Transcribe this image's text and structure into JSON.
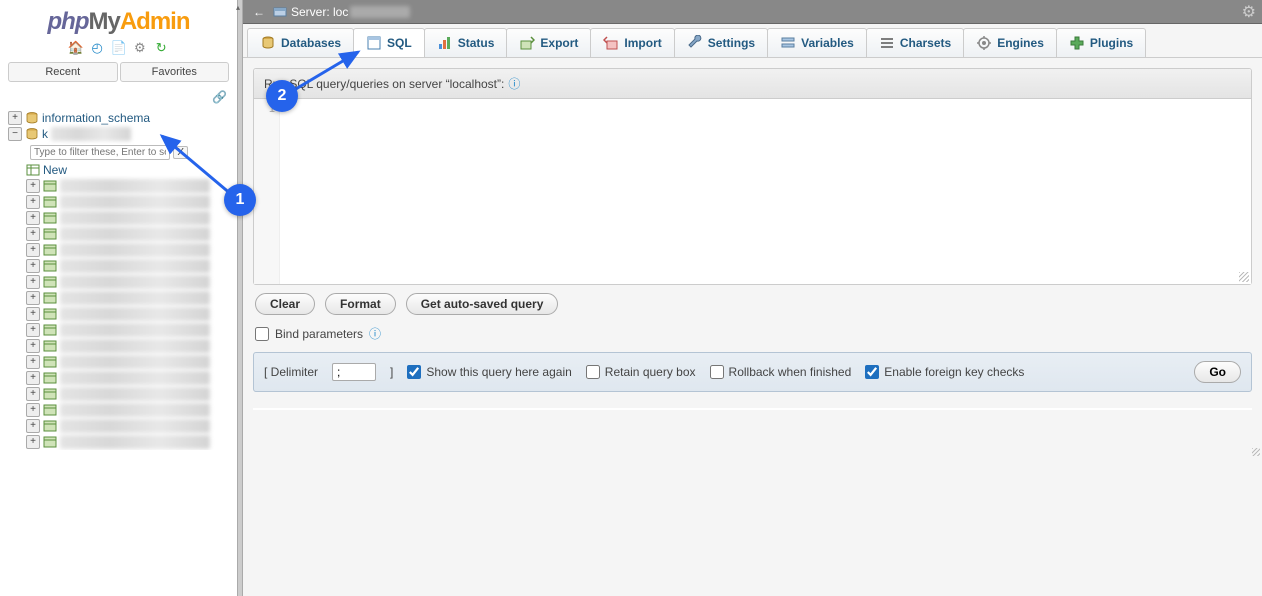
{
  "logo": {
    "php": "php",
    "my": "My",
    "admin": "Admin"
  },
  "sidebar_tabs": {
    "recent": "Recent",
    "favorites": "Favorites"
  },
  "tree": {
    "db1": "information_schema",
    "db2": "k",
    "filter_placeholder": "Type to filter these, Enter to search",
    "filter_x": "X",
    "new": "New"
  },
  "topbar": {
    "server_label": "Server: loc"
  },
  "tabs": {
    "databases": "Databases",
    "sql": "SQL",
    "status": "Status",
    "export": "Export",
    "import": "Import",
    "settings": "Settings",
    "variables": "Variables",
    "charsets": "Charsets",
    "engines": "Engines",
    "plugins": "Plugins"
  },
  "sql": {
    "header": "Run SQL query/queries on server “localhost”:",
    "line1": "1",
    "clear": "Clear",
    "format": "Format",
    "get_autosaved": "Get auto-saved query",
    "bind_params": "Bind parameters"
  },
  "options": {
    "delimiter_label_open": "[ Delimiter",
    "delimiter_value": ";",
    "delimiter_label_close": "]",
    "show_again": "Show this query here again",
    "retain": "Retain query box",
    "rollback": "Rollback when finished",
    "fk": "Enable foreign key checks",
    "go": "Go"
  },
  "annotations": {
    "one": "1",
    "two": "2"
  }
}
